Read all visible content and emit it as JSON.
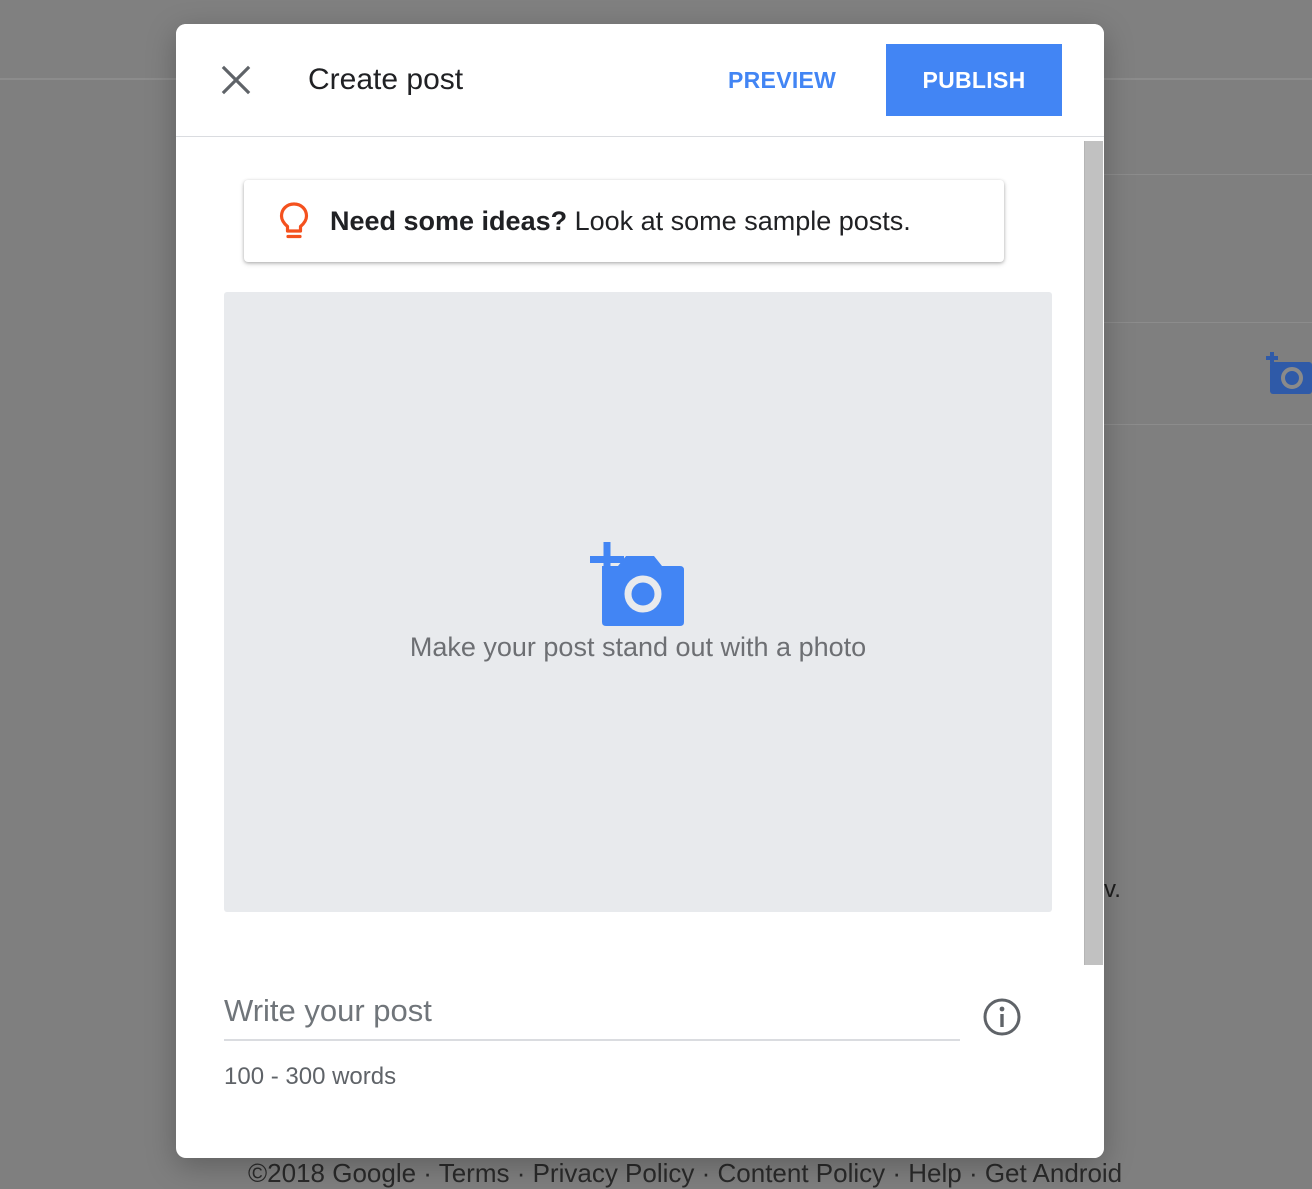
{
  "dialog": {
    "title": "Create post",
    "preview_label": "PREVIEW",
    "publish_label": "PUBLISH"
  },
  "ideas": {
    "bold_text": "Need some ideas?",
    "text": " Look at some sample posts."
  },
  "photo": {
    "label": "Make your post stand out with a photo"
  },
  "post": {
    "placeholder": "Write your post",
    "value": "",
    "helper": "100 - 300 words"
  },
  "background": {
    "fragment": "v.",
    "footer": "©2018 Google · Terms · Privacy Policy · Content Policy · Help · Get Android"
  },
  "colors": {
    "accent": "#4285f4",
    "bulb": "#f4511e",
    "photo_bg": "#e8eaed"
  },
  "icons": [
    "close-icon",
    "lightbulb-icon",
    "add-photo-icon",
    "info-icon"
  ]
}
